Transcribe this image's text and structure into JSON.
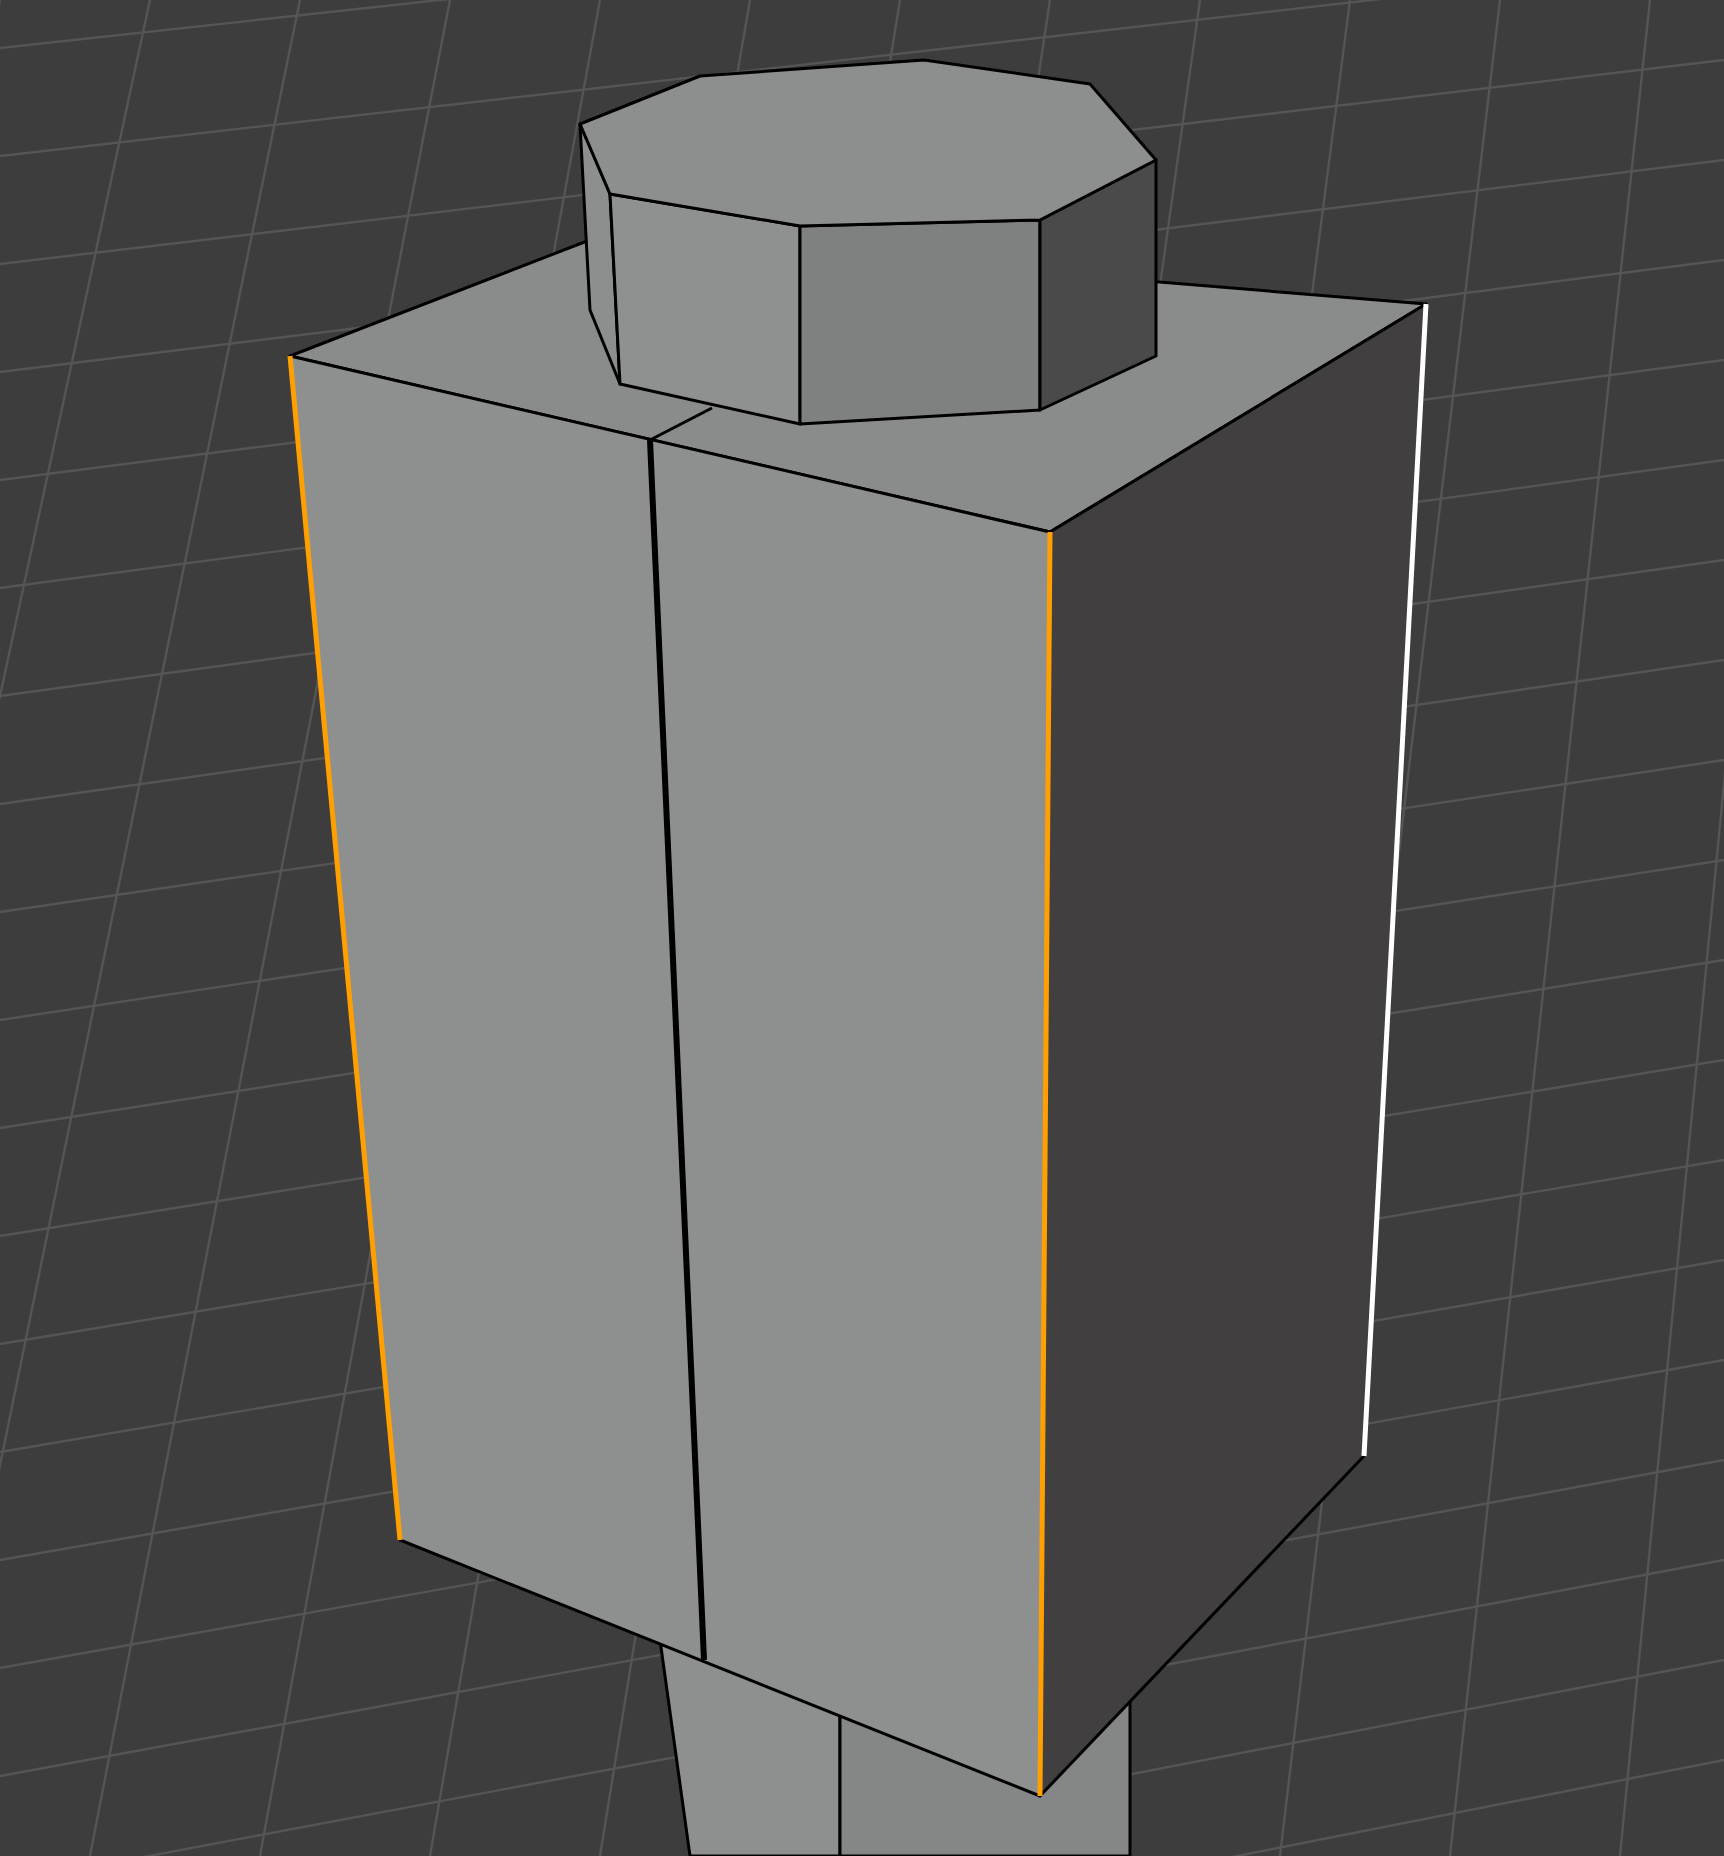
{
  "viewport": {
    "edges": [
      {
        "selected": true,
        "active": false
      },
      {
        "selected": true,
        "active": false
      },
      {
        "selected": true,
        "active": true
      }
    ]
  }
}
